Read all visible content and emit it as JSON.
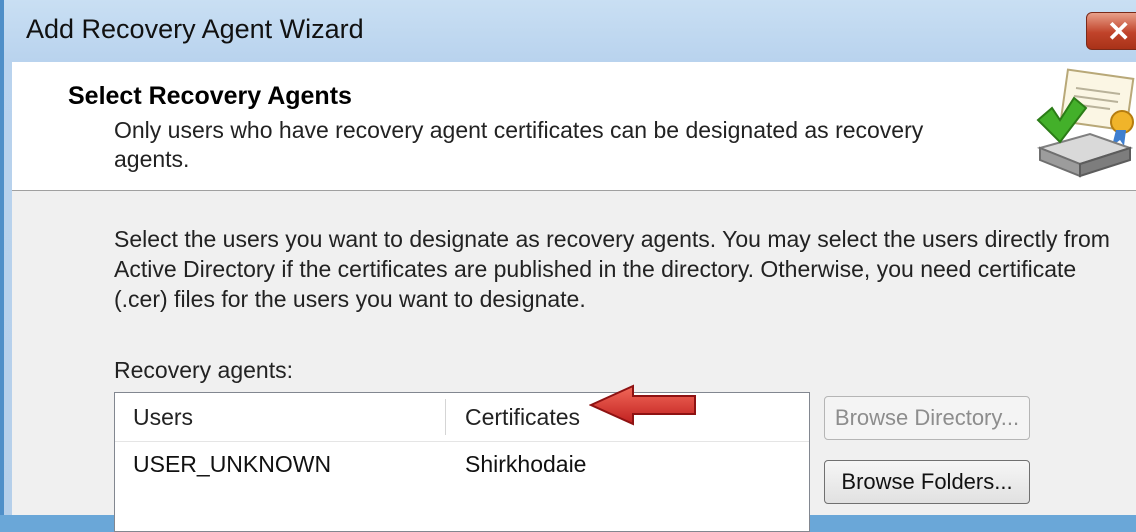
{
  "window": {
    "title": "Add Recovery Agent Wizard",
    "close_glyph": "✕"
  },
  "header": {
    "title": "Select Recovery Agents",
    "description": "Only users who have recovery agent certificates can be designated as recovery agents.",
    "icon": "certificate-drive-icon"
  },
  "body": {
    "instructions": "Select the users you want to designate as recovery agents. You may select the users directly from Active Directory if the certificates are published in the directory. Otherwise, you need certificate (.cer) files for the users you want to designate.",
    "list_label": "Recovery agents:"
  },
  "agents_table": {
    "columns": [
      "Users",
      "Certificates"
    ],
    "rows": [
      {
        "user": "USER_UNKNOWN",
        "certificate": "Shirkhodaie"
      }
    ]
  },
  "buttons": {
    "browse_directory": "Browse Directory...",
    "browse_folders": "Browse Folders..."
  },
  "colors": {
    "annotation_arrow": "#d92b2b",
    "close_button": "#c0432a"
  }
}
